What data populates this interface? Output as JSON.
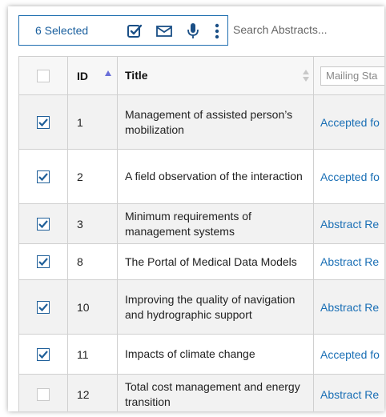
{
  "toolbar": {
    "selected_label": "6 Selected",
    "search_placeholder": "Search Abstracts...",
    "icons": [
      "check-square-icon",
      "mail-icon",
      "microphone-icon",
      "more-vertical-icon"
    ],
    "accent_color": "#1a5f9e"
  },
  "table": {
    "columns": {
      "id": "ID",
      "title": "Title",
      "status_placeholder": "Mailing Sta"
    },
    "rows": [
      {
        "id": "1",
        "title": "Management of assisted person’s mobilization",
        "status": "Accepted fo",
        "selected": true
      },
      {
        "id": "2",
        "title": "A field observation of the interaction",
        "status": "Accepted fo",
        "selected": true
      },
      {
        "id": "3",
        "title": "Minimum requirements of management systems",
        "status": "Abstract Re",
        "selected": true
      },
      {
        "id": "8",
        "title": "The Portal of Medical Data Models",
        "status": "Abstract Re",
        "selected": true
      },
      {
        "id": "10",
        "title": "Improving the quality of navigation and hydrographic support",
        "status": "Abstract Re",
        "selected": true
      },
      {
        "id": "11",
        "title": "Impacts of climate change",
        "status": "Accepted fo",
        "selected": true
      },
      {
        "id": "12",
        "title": "Total cost management and energy transition",
        "status": "Abstract Re",
        "selected": false
      }
    ],
    "link_color": "#1a6fb5"
  }
}
